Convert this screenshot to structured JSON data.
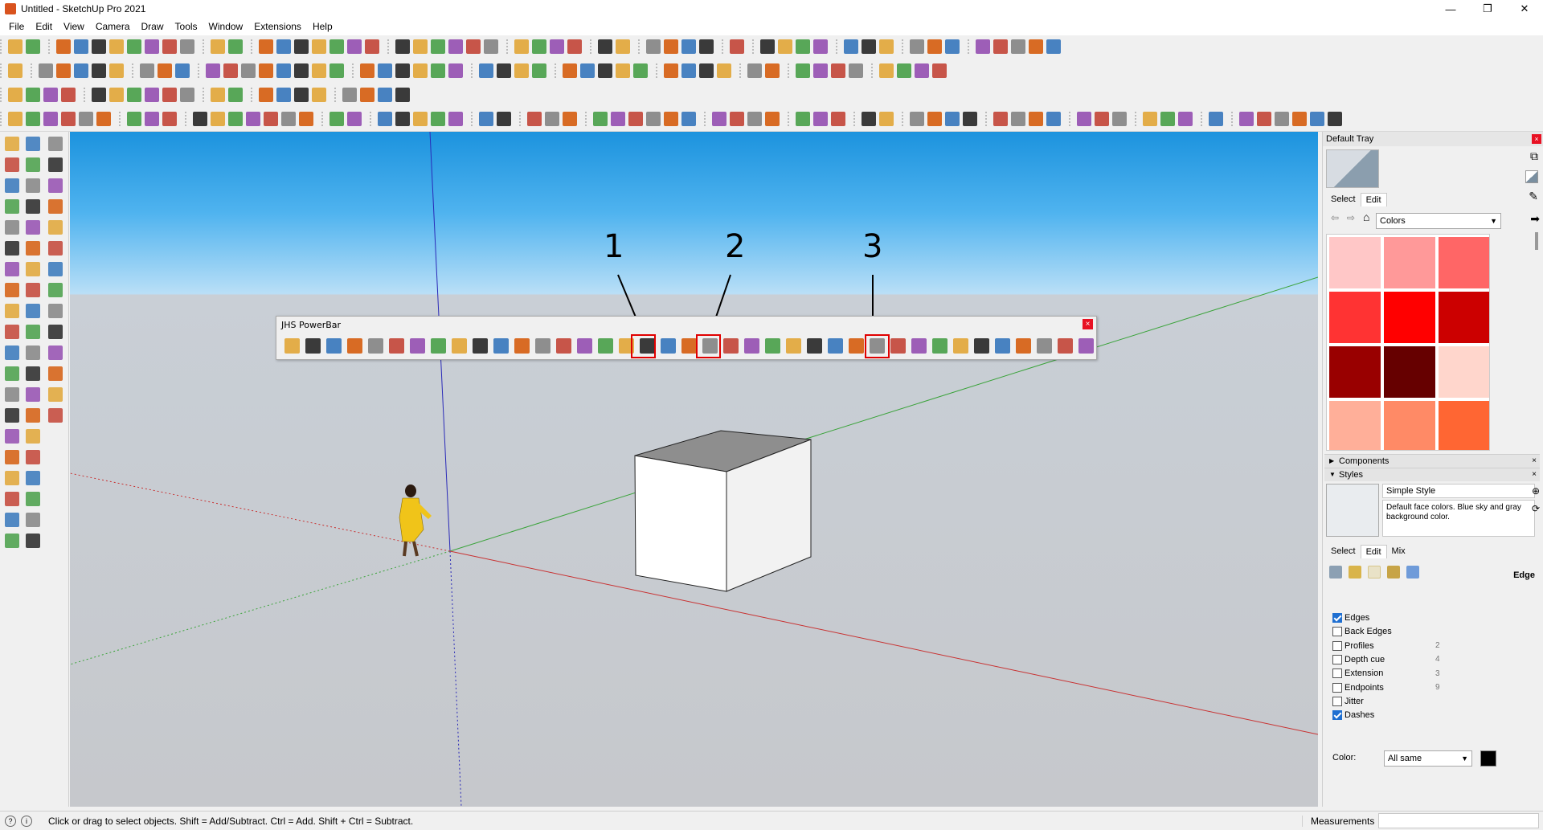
{
  "window": {
    "title": "Untitled - SketchUp Pro 2021",
    "controls": [
      "—",
      "❐",
      "✕"
    ]
  },
  "menu": [
    "File",
    "Edit",
    "View",
    "Camera",
    "Draw",
    "Tools",
    "Window",
    "Extensions",
    "Help"
  ],
  "powerbar": {
    "title": "JHS PowerBar",
    "close": "×",
    "callouts": [
      "1",
      "2",
      "3"
    ]
  },
  "tray": {
    "title": "Default Tray",
    "materials_tabs": [
      "Select",
      "Edit"
    ],
    "materials_dropdown": "Colors",
    "swatches": [
      "#ffc7c7",
      "#ff9999",
      "#ff6666",
      "#ff3333",
      "#ff0000",
      "#cc0000",
      "#990000",
      "#660000",
      "#ffd6cc",
      "#ffaf99",
      "#ff8a66",
      "#ff6633"
    ],
    "components_label": "Components",
    "styles_label": "Styles",
    "style_name": "Simple Style",
    "style_desc": "Default face colors. Blue sky and gray background color.",
    "styles_tabs": [
      "Select",
      "Edit",
      "Mix"
    ],
    "edge_label": "Edge",
    "edge_settings": [
      {
        "label": "Edges",
        "checked": true,
        "value": ""
      },
      {
        "label": "Back Edges",
        "checked": false,
        "value": ""
      },
      {
        "label": "Profiles",
        "checked": false,
        "value": "2"
      },
      {
        "label": "Depth cue",
        "checked": false,
        "value": "4"
      },
      {
        "label": "Extension",
        "checked": false,
        "value": "3"
      },
      {
        "label": "Endpoints",
        "checked": false,
        "value": "9"
      },
      {
        "label": "Jitter",
        "checked": false,
        "value": ""
      },
      {
        "label": "Dashes",
        "checked": true,
        "value": ""
      }
    ],
    "color_label": "Color:",
    "color_value": "All same"
  },
  "status": {
    "message": "Click or drag to select objects. Shift = Add/Subtract. Ctrl = Add. Shift + Ctrl = Subtract.",
    "measurements_label": "Measurements"
  },
  "icons": {
    "toolbar_palette": [
      "#e0a12b",
      "#c0392b",
      "#2a6fb8",
      "#3d9a3d",
      "#7d7d7d",
      "#1a1a1a",
      "#8e44ad",
      "#d35400"
    ]
  }
}
